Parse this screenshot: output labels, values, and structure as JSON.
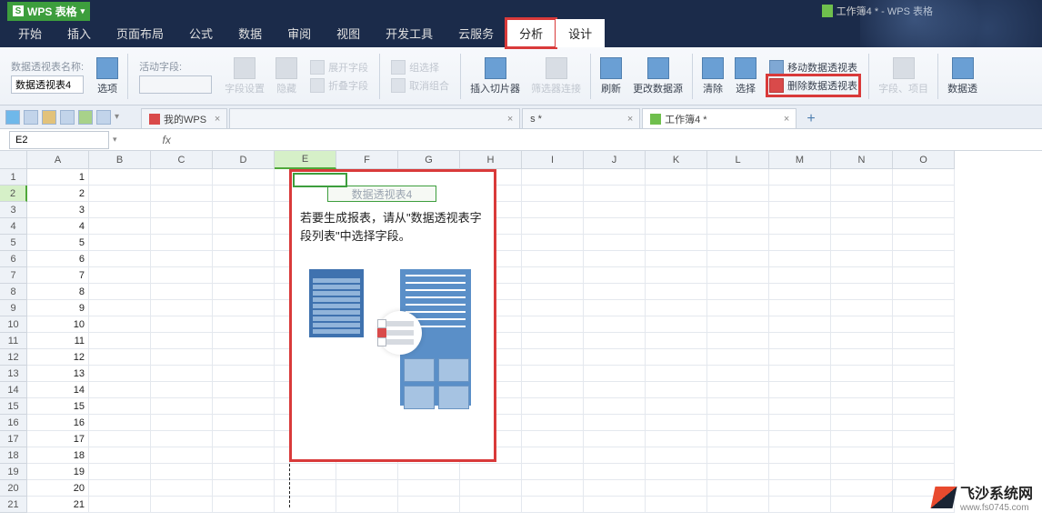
{
  "app": {
    "brand": "WPS 表格",
    "doc_title": "工作簿4 * - WPS 表格"
  },
  "menu": {
    "tabs": [
      "开始",
      "插入",
      "页面布局",
      "公式",
      "数据",
      "审阅",
      "视图",
      "开发工具",
      "云服务",
      "分析",
      "设计"
    ],
    "active_index": 9
  },
  "ribbon": {
    "pivot_name_label": "数据透视表名称:",
    "pivot_name_value": "数据透视表4",
    "options": "选项",
    "active_field_label": "活动字段:",
    "field_settings": "字段设置",
    "hide": "隐藏",
    "expand_field": "展开字段",
    "collapse_field": "折叠字段",
    "group_select": "组选择",
    "ungroup": "取消组合",
    "insert_slicer": "插入切片器",
    "filter_conn": "筛选器连接",
    "refresh": "刷新",
    "change_source": "更改数据源",
    "clear": "清除",
    "select": "选择",
    "move_pivot": "移动数据透视表",
    "delete_pivot": "删除数据透视表",
    "fields_items": "字段、项目",
    "data_pivot": "数据透"
  },
  "doc_tabs": {
    "t1": "我的WPS",
    "t2": "s *",
    "t3": "工作簿4 *"
  },
  "cell_ref": "E2",
  "columns": [
    "A",
    "B",
    "C",
    "D",
    "E",
    "F",
    "G",
    "H",
    "I",
    "J",
    "K",
    "L",
    "M",
    "N",
    "O"
  ],
  "selected_col_index": 4,
  "row_count": 21,
  "selected_row": 2,
  "col_a_values": [
    1,
    2,
    3,
    4,
    5,
    6,
    7,
    8,
    9,
    10,
    11,
    12,
    13,
    14,
    15,
    16,
    17,
    18,
    19,
    20,
    21
  ],
  "pivot": {
    "title": "数据透视表4",
    "hint": "若要生成报表，请从\"数据透视表字段列表\"中选择字段。"
  },
  "watermark": {
    "name": "飞沙系统网",
    "url": "www.fs0745.com"
  }
}
